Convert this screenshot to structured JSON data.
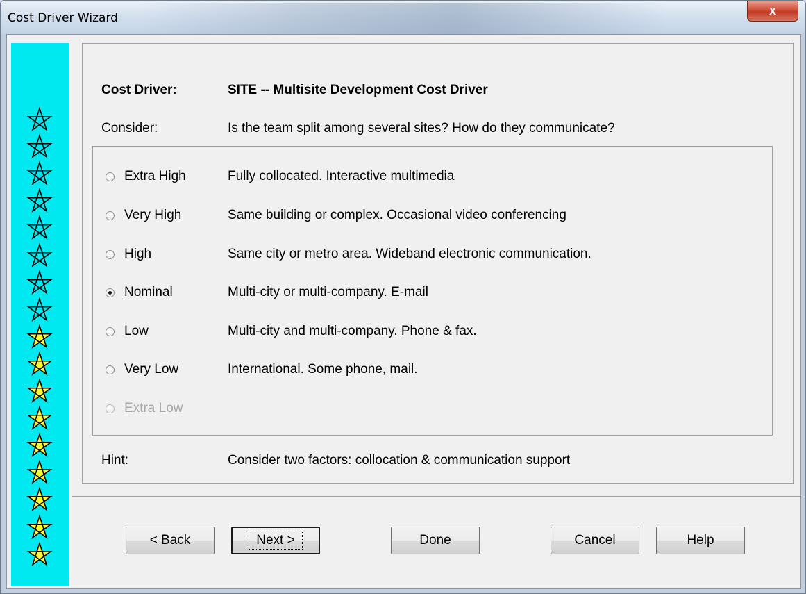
{
  "window": {
    "title": "Cost Driver Wizard",
    "close_glyph": "x"
  },
  "cost_driver": {
    "label": "Cost Driver:",
    "value": "SITE -- Multisite Development Cost Driver"
  },
  "consider": {
    "label": "Consider:",
    "value": "Is the team split among several sites?  How do they communicate?"
  },
  "options": [
    {
      "label": "Extra High",
      "desc": "Fully collocated.  Interactive multimedia",
      "checked": false,
      "disabled": false
    },
    {
      "label": "Very High",
      "desc": "Same building or complex.  Occasional video conferencing",
      "checked": false,
      "disabled": false
    },
    {
      "label": "High",
      "desc": "Same city or metro area.  Wideband electronic communication.",
      "checked": false,
      "disabled": false
    },
    {
      "label": "Nominal",
      "desc": "Multi-city or multi-company.  E-mail",
      "checked": true,
      "disabled": false
    },
    {
      "label": "Low",
      "desc": "Multi-city and multi-company.  Phone & fax.",
      "checked": false,
      "disabled": false
    },
    {
      "label": "Very Low",
      "desc": "International.  Some phone, mail.",
      "checked": false,
      "disabled": false
    },
    {
      "label": "Extra Low",
      "desc": "",
      "checked": false,
      "disabled": true
    }
  ],
  "hint": {
    "label": "Hint:",
    "value": "Consider two factors: collocation & communication support"
  },
  "buttons": {
    "back": "< Back",
    "next": "Next >",
    "done": "Done",
    "cancel": "Cancel",
    "help": "Help"
  },
  "star_progress": {
    "total": 17,
    "filled": 9,
    "outline_color": "#000000",
    "filled_color": "#ffff33",
    "sidebar_color": "#00e9f0"
  }
}
